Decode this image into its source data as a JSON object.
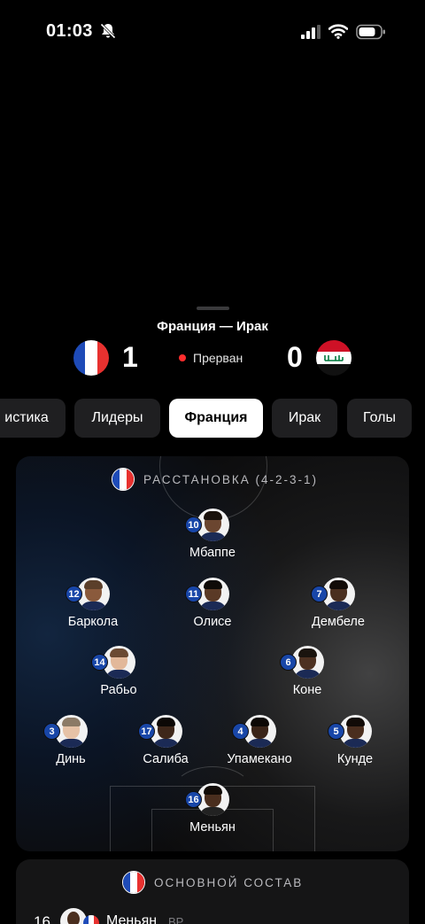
{
  "status_bar": {
    "time": "01:03"
  },
  "match": {
    "title": "Франция — Ирак",
    "home_score": "1",
    "away_score": "0",
    "status": "Прерван",
    "status_color": "#ff2d2d"
  },
  "tabs": [
    {
      "label": "истика",
      "active": false
    },
    {
      "label": "Лидеры",
      "active": false
    },
    {
      "label": "Франция",
      "active": true
    },
    {
      "label": "Ирак",
      "active": false
    },
    {
      "label": "Голы",
      "active": false
    }
  ],
  "formation": {
    "heading": "РАССТАНОВКА (4-2-3-1)",
    "players": [
      {
        "number": "10",
        "name": "Мбаппе"
      },
      {
        "number": "12",
        "name": "Баркола"
      },
      {
        "number": "11",
        "name": "Олисе"
      },
      {
        "number": "7",
        "name": "Дембеле"
      },
      {
        "number": "14",
        "name": "Рабьо"
      },
      {
        "number": "6",
        "name": "Коне"
      },
      {
        "number": "3",
        "name": "Динь"
      },
      {
        "number": "17",
        "name": "Салиба"
      },
      {
        "number": "4",
        "name": "Упамекано"
      },
      {
        "number": "5",
        "name": "Кунде"
      },
      {
        "number": "16",
        "name": "Меньян"
      }
    ]
  },
  "lineup": {
    "heading": "ОСНОВНОЙ СОСТАВ",
    "first": {
      "number": "16",
      "name": "Меньян",
      "position": "ВР"
    }
  },
  "colors": {
    "france_blue": "#1e4bb8",
    "france_red": "#e8312f",
    "iraq_red": "#ce1126",
    "iraq_green": "#007a3d",
    "number_badge": "#1846a8"
  },
  "icons": [
    "bell-slash-icon",
    "cellular-signal-icon",
    "wifi-icon",
    "battery-icon",
    "france-flag-icon",
    "iraq-flag-icon"
  ]
}
